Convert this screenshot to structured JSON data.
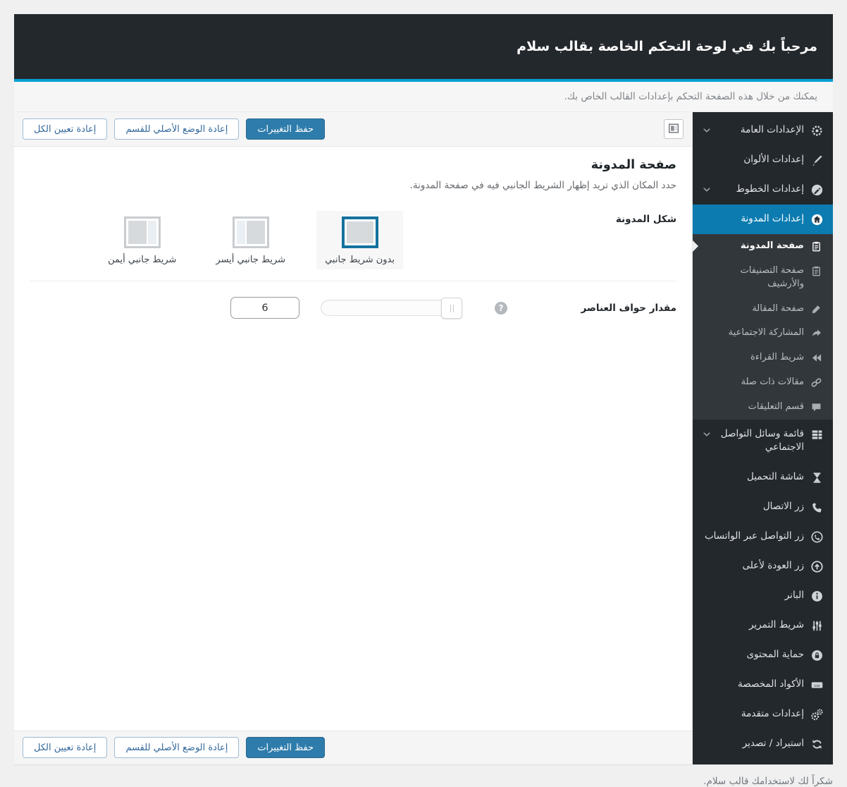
{
  "header": {
    "title": "مرحباً بك في لوحة التحكم الخاصة بقالب سلام"
  },
  "intro": {
    "text": "يمكنك من خلال هذه الصفحة التحكم بإعدادات القالب الخاص بك."
  },
  "toolbar": {
    "save_label": "حفظ التغييرات",
    "reset_section_label": "إعادة الوضع الأصلي للقسم",
    "reset_all_label": "إعادة تعيين الكل",
    "layout_toggle_icon": "layout-toggle-icon"
  },
  "sidebar": {
    "items": [
      {
        "id": "general-settings",
        "label": "الإعدادات العامة",
        "icon": "gear-icon",
        "type": "top",
        "expandable": true
      },
      {
        "id": "color-settings",
        "label": "إعدادات الألوان",
        "icon": "brush-icon",
        "type": "top"
      },
      {
        "id": "font-settings",
        "label": "إعدادات الخطوط",
        "icon": "pencil-circle-icon",
        "type": "top",
        "expandable": true
      },
      {
        "id": "blog-settings",
        "label": "إعدادات المدونة",
        "icon": "home-icon",
        "type": "top",
        "active": true
      },
      {
        "id": "blog-page",
        "label": "صفحة المدونة",
        "icon": "clipboard-icon",
        "type": "sub",
        "active_sub": true
      },
      {
        "id": "categories-archive-page",
        "label": "صفحة التصنيفات والأرشيف",
        "icon": "clipboard-icon",
        "type": "sub"
      },
      {
        "id": "article-page",
        "label": "صفحة المقالة",
        "icon": "pencil-icon",
        "type": "sub"
      },
      {
        "id": "social-sharing",
        "label": "المشاركة الاجتماعية",
        "icon": "share-icon",
        "type": "sub"
      },
      {
        "id": "reading-bar",
        "label": "شريط القراءة",
        "icon": "rewind-icon",
        "type": "sub"
      },
      {
        "id": "related-articles",
        "label": "مقالات ذات صلة",
        "icon": "link-icon",
        "type": "sub"
      },
      {
        "id": "comments-section",
        "label": "قسم التعليقات",
        "icon": "comment-icon",
        "type": "sub"
      },
      {
        "id": "social-media-list",
        "label": "قائمة وسائل التواصل الاجتماعي",
        "icon": "list-icon",
        "type": "top",
        "expandable": true
      },
      {
        "id": "loading-screen",
        "label": "شاشة التحميل",
        "icon": "hourglass-icon",
        "type": "top"
      },
      {
        "id": "call-button",
        "label": "زر الاتصال",
        "icon": "phone-icon",
        "type": "top"
      },
      {
        "id": "whatsapp-button",
        "label": "زر التواصل عبر الواتساب",
        "icon": "whatsapp-icon",
        "type": "top"
      },
      {
        "id": "back-to-top-button",
        "label": "زر العودة لأعلى",
        "icon": "arrow-up-circle-icon",
        "type": "top"
      },
      {
        "id": "banner",
        "label": "البانر",
        "icon": "info-icon",
        "type": "top"
      },
      {
        "id": "scroll-bar",
        "label": "شريط التمرير",
        "icon": "sliders-icon",
        "type": "top"
      },
      {
        "id": "content-protection",
        "label": "حماية المحتوى",
        "icon": "lock-icon",
        "type": "top"
      },
      {
        "id": "custom-codes",
        "label": "الأكواد المخصصة",
        "icon": "css-icon",
        "type": "top"
      },
      {
        "id": "advanced-settings",
        "label": "إعدادات متقدمة",
        "icon": "gears-icon",
        "type": "top"
      },
      {
        "id": "import-export",
        "label": "استيراد / تصدير",
        "icon": "sync-icon",
        "type": "top"
      }
    ]
  },
  "main": {
    "section_title": "صفحة المدونة",
    "section_desc": "حدد المكان الذي تريد إظهار الشريط الجانبي فيه في صفحة المدونة.",
    "layout_row": {
      "label": "شكل المدونة",
      "options": [
        {
          "id": "no-sidebar",
          "label": "بدون شريط جانبي",
          "variant": "none",
          "selected": true
        },
        {
          "id": "left-sidebar",
          "label": "شريط جانبي أيسر",
          "variant": "left",
          "selected": false
        },
        {
          "id": "right-sidebar",
          "label": "شريط جانبي أيمن",
          "variant": "right",
          "selected": false
        }
      ]
    },
    "padding_row": {
      "label": "مقدار حواف العناصر",
      "value": "6",
      "help_icon": "question-icon"
    }
  },
  "footer": {
    "text": "شكراً لك لاستخدامك قالب سلام."
  },
  "colors": {
    "sidebar_dark": "#23282d",
    "submenu_dark": "#32373c",
    "active_item_blue": "#0c7cb0",
    "header_underline": "#00a0d2",
    "primary_button": "#2e7cab",
    "selected_option_border": "#15729f"
  }
}
